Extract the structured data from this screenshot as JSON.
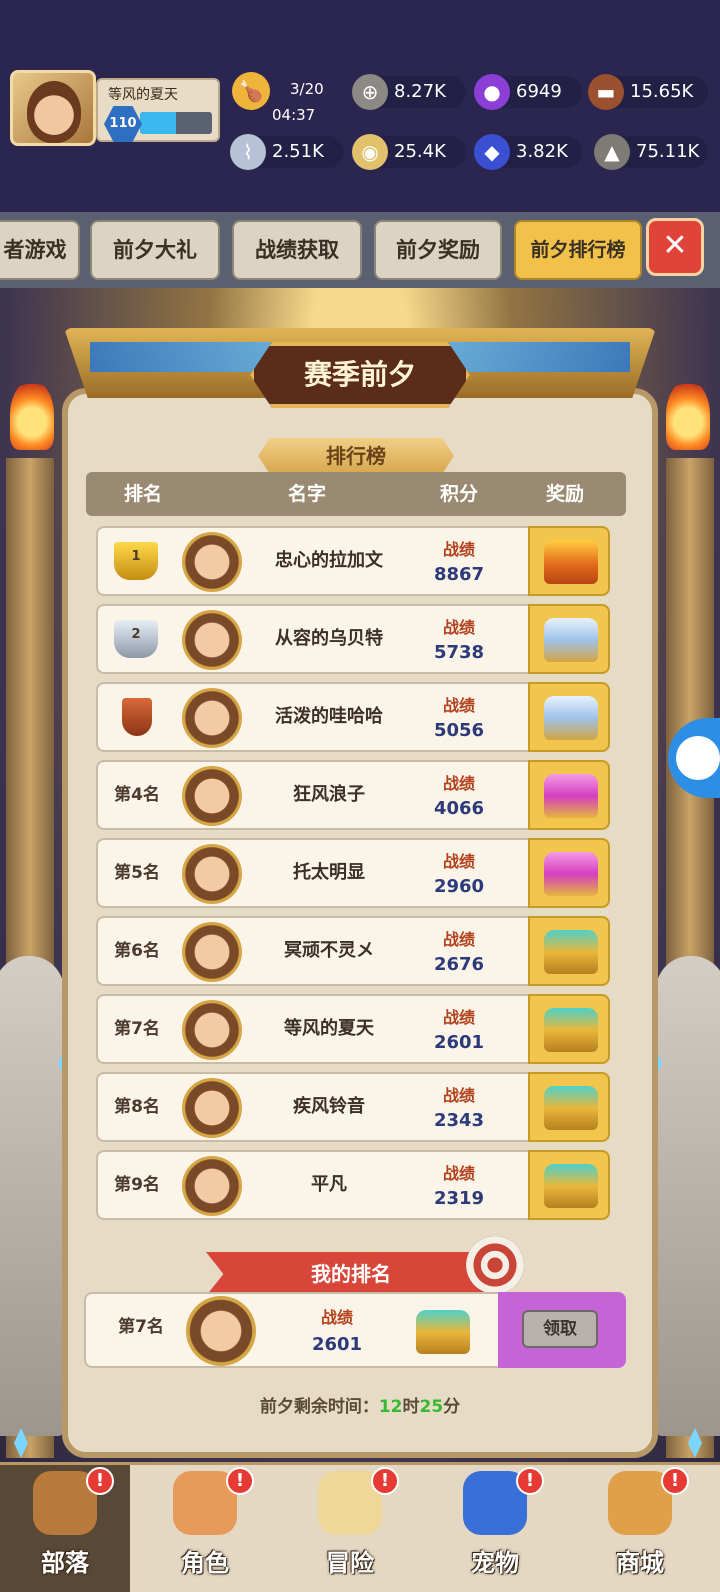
{
  "player": {
    "name": "等风的夏天",
    "level": "110",
    "xp_fraction": 0.5
  },
  "resources": {
    "energy": {
      "value": "3/20",
      "timer": "04:37"
    },
    "items": [
      {
        "icon": "stone-coin-icon",
        "value": "8.27K"
      },
      {
        "icon": "purple-orb-icon",
        "value": "6949"
      },
      {
        "icon": "wood-logs-icon",
        "value": "15.65K"
      },
      {
        "icon": "bone-icon",
        "value": "2.51K"
      },
      {
        "icon": "gold-coin-icon",
        "value": "25.4K"
      },
      {
        "icon": "blue-gem-icon",
        "value": "3.82K"
      },
      {
        "icon": "ore-rock-icon",
        "value": "75.11K"
      }
    ]
  },
  "tabs": [
    {
      "label": "者游戏"
    },
    {
      "label": "前夕大礼"
    },
    {
      "label": "战绩获取"
    },
    {
      "label": "前夕奖励"
    },
    {
      "label": "前夕排行榜",
      "active": true
    }
  ],
  "banner": {
    "title": "赛季前夕",
    "subtitle": "排行榜"
  },
  "columns": {
    "rank": "排名",
    "name": "名字",
    "score": "积分",
    "reward": "奖励"
  },
  "score_label": "战绩",
  "rows": [
    {
      "rank": "1",
      "name": "忠心的拉加文",
      "score": "8867",
      "chest": "gold"
    },
    {
      "rank": "2",
      "name": "从容的乌贝特",
      "score": "5738",
      "chest": "diamond"
    },
    {
      "rank": "",
      "name": "活泼的哇哈哈",
      "score": "5056",
      "chest": "diamond"
    },
    {
      "rank": "第4名",
      "name": "狂风浪子",
      "score": "4066",
      "chest": "pink"
    },
    {
      "rank": "第5名",
      "name": "托太明显",
      "score": "2960",
      "chest": "pink"
    },
    {
      "rank": "第6名",
      "name": "冥顽不灵メ",
      "score": "2676",
      "chest": "teal"
    },
    {
      "rank": "第7名",
      "name": "等风的夏天",
      "score": "2601",
      "chest": "teal"
    },
    {
      "rank": "第8名",
      "name": "疾风铃音",
      "score": "2343",
      "chest": "teal"
    },
    {
      "rank": "第9名",
      "name": "平凡",
      "score": "2319",
      "chest": "teal"
    }
  ],
  "my_rank": {
    "ribbon": "我的排名",
    "rank": "第7名",
    "score_label": "战绩",
    "score": "2601",
    "claim": "领取"
  },
  "countdown": {
    "prefix": "前夕剩余时间：",
    "hours": "12",
    "hours_unit": "时",
    "minutes": "25",
    "minutes_unit": "分"
  },
  "nav": [
    {
      "label": "部落",
      "icon": "tribe-icon",
      "active": true,
      "badge": "!"
    },
    {
      "label": "角色",
      "icon": "character-icon",
      "badge": "!"
    },
    {
      "label": "冒险",
      "icon": "map-icon",
      "badge": "!"
    },
    {
      "label": "宠物",
      "icon": "pet-icon",
      "badge": "!"
    },
    {
      "label": "商城",
      "icon": "shop-icon",
      "badge": "!"
    }
  ],
  "colors": {
    "accent": "#f1c14a",
    "score_blue": "#2d3a7a",
    "score_label": "#b3431f",
    "timer_green": "#38b832",
    "ribbon_red": "#d8463a",
    "claim_purple": "#c663d6"
  }
}
